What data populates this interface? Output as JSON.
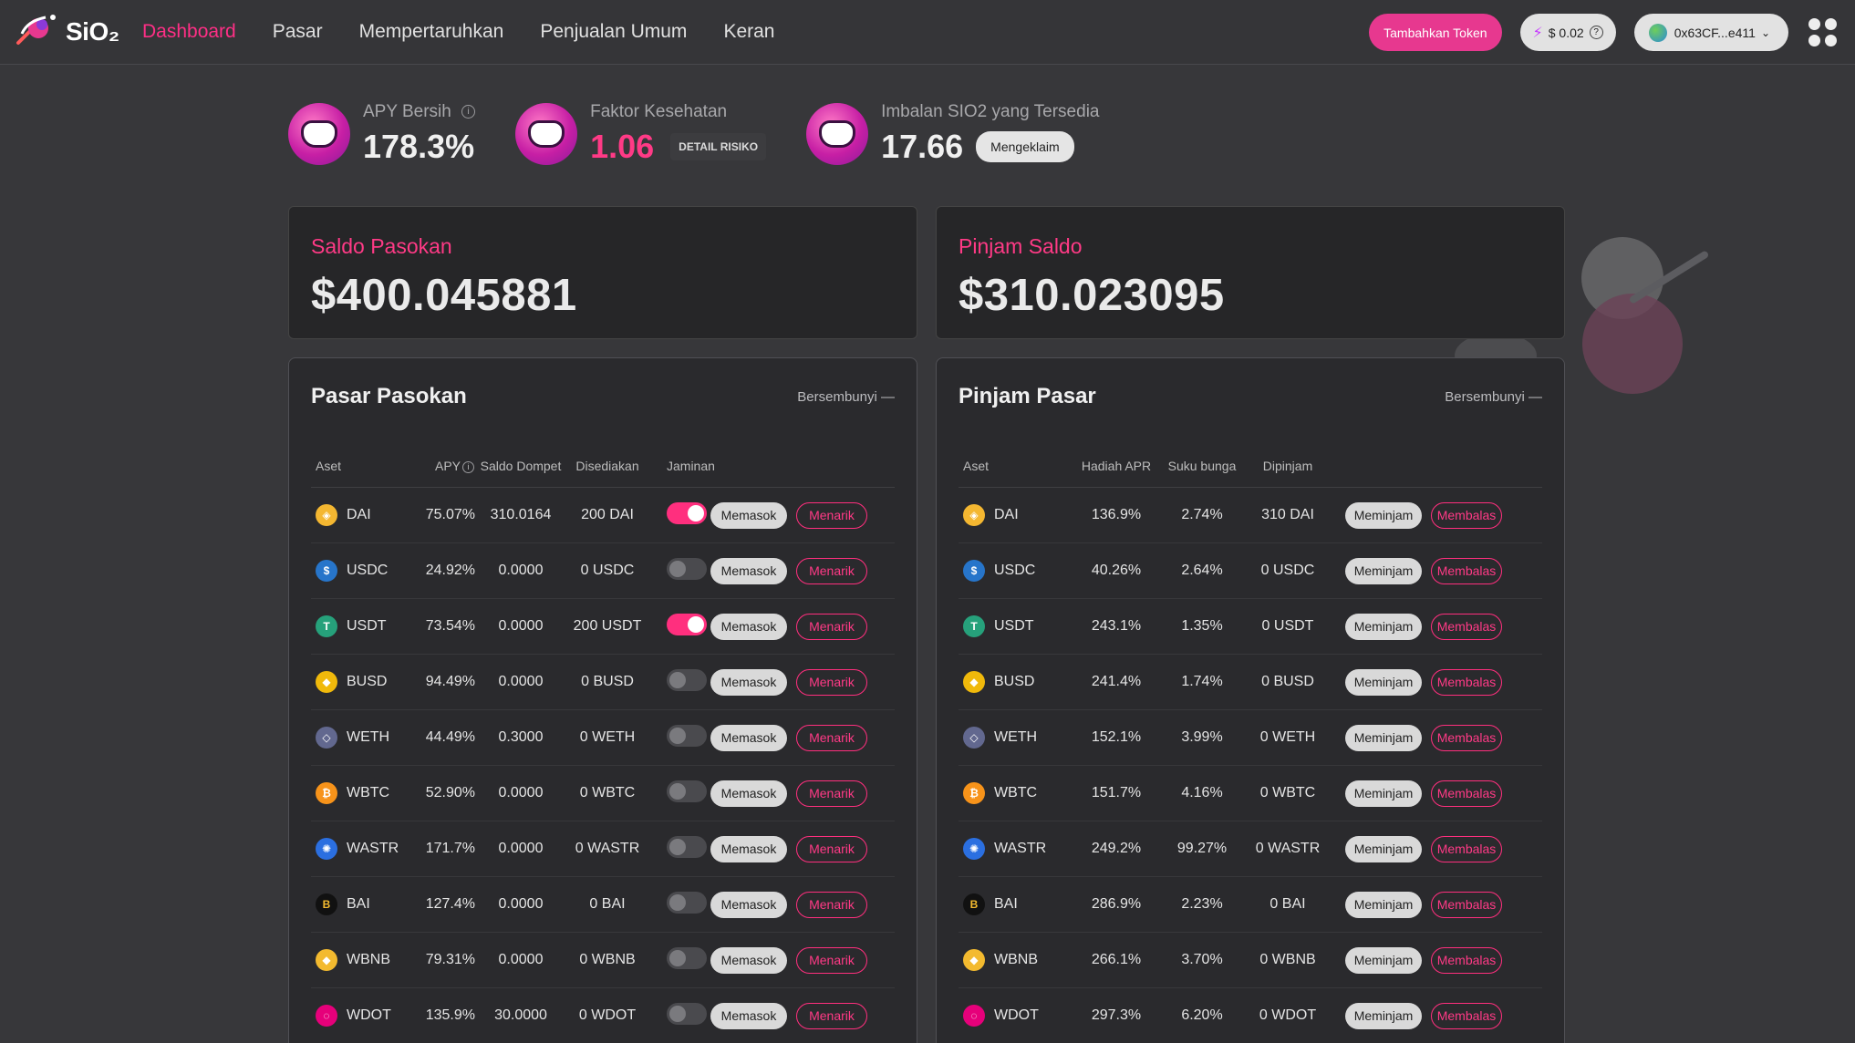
{
  "nav": {
    "logo_text": "SiO₂",
    "links": [
      "Dashboard",
      "Pasar",
      "Mempertaruhkan",
      "Penjualan Umum",
      "Keran"
    ],
    "add_token": "Tambahkan Token",
    "price": "$ 0.02",
    "wallet": "0x63CF...e411"
  },
  "stats": {
    "apy_label": "APY Bersih",
    "apy_value": "178.3%",
    "health_label": "Faktor Kesehatan",
    "health_value": "1.06",
    "risk_detail": "DETAIL RISIKO",
    "reward_label": "Imbalan SIO2 yang Tersedia",
    "reward_value": "17.66",
    "claim": "Mengeklaim"
  },
  "supply_balance": {
    "title": "Saldo Pasokan",
    "value": "$400.045881"
  },
  "borrow_balance": {
    "title": "Pinjam Saldo",
    "value": "$310.023095"
  },
  "supply_market": {
    "title": "Pasar Pasokan",
    "hide": "Bersembunyi —",
    "headers": [
      "Aset",
      "APY",
      "Saldo Dompet",
      "Disediakan",
      "Jaminan"
    ],
    "supply_btn": "Memasok",
    "withdraw_btn": "Menarik",
    "rows": [
      {
        "asset": "DAI",
        "apy": "75.07%",
        "wallet": "310.0164",
        "supplied": "200 DAI",
        "collateral": true
      },
      {
        "asset": "USDC",
        "apy": "24.92%",
        "wallet": "0.0000",
        "supplied": "0 USDC",
        "collateral": false
      },
      {
        "asset": "USDT",
        "apy": "73.54%",
        "wallet": "0.0000",
        "supplied": "200 USDT",
        "collateral": true
      },
      {
        "asset": "BUSD",
        "apy": "94.49%",
        "wallet": "0.0000",
        "supplied": "0 BUSD",
        "collateral": false
      },
      {
        "asset": "WETH",
        "apy": "44.49%",
        "wallet": "0.3000",
        "supplied": "0 WETH",
        "collateral": false
      },
      {
        "asset": "WBTC",
        "apy": "52.90%",
        "wallet": "0.0000",
        "supplied": "0 WBTC",
        "collateral": false
      },
      {
        "asset": "WASTR",
        "apy": "171.7%",
        "wallet": "0.0000",
        "supplied": "0 WASTR",
        "collateral": false
      },
      {
        "asset": "BAI",
        "apy": "127.4%",
        "wallet": "0.0000",
        "supplied": "0 BAI",
        "collateral": false
      },
      {
        "asset": "WBNB",
        "apy": "79.31%",
        "wallet": "0.0000",
        "supplied": "0 WBNB",
        "collateral": false
      },
      {
        "asset": "WDOT",
        "apy": "135.9%",
        "wallet": "30.0000",
        "supplied": "0 WDOT",
        "collateral": false
      }
    ]
  },
  "borrow_market": {
    "title": "Pinjam Pasar",
    "hide": "Bersembunyi —",
    "headers": [
      "Aset",
      "Hadiah APR",
      "Suku bunga",
      "Dipinjam"
    ],
    "borrow_btn": "Meminjam",
    "repay_btn": "Membalas",
    "rows": [
      {
        "asset": "DAI",
        "reward": "136.9%",
        "rate": "2.74%",
        "borrowed": "310 DAI"
      },
      {
        "asset": "USDC",
        "reward": "40.26%",
        "rate": "2.64%",
        "borrowed": "0 USDC"
      },
      {
        "asset": "USDT",
        "reward": "243.1%",
        "rate": "1.35%",
        "borrowed": "0 USDT"
      },
      {
        "asset": "BUSD",
        "reward": "241.4%",
        "rate": "1.74%",
        "borrowed": "0 BUSD"
      },
      {
        "asset": "WETH",
        "reward": "152.1%",
        "rate": "3.99%",
        "borrowed": "0 WETH"
      },
      {
        "asset": "WBTC",
        "reward": "151.7%",
        "rate": "4.16%",
        "borrowed": "0 WBTC"
      },
      {
        "asset": "WASTR",
        "reward": "249.2%",
        "rate": "99.27%",
        "borrowed": "0 WASTR"
      },
      {
        "asset": "BAI",
        "reward": "286.9%",
        "rate": "2.23%",
        "borrowed": "0 BAI"
      },
      {
        "asset": "WBNB",
        "reward": "266.1%",
        "rate": "3.70%",
        "borrowed": "0 WBNB"
      },
      {
        "asset": "WDOT",
        "reward": "297.3%",
        "rate": "6.20%",
        "borrowed": "0 WDOT"
      }
    ]
  },
  "coin_colors": {
    "DAI": "#f4b731",
    "USDC": "#2775ca",
    "USDT": "#26a17b",
    "BUSD": "#f0b90b",
    "WETH": "#62688f",
    "WBTC": "#f7931a",
    "WASTR": "#2b6fe0",
    "BAI": "#111111",
    "WBNB": "#f3ba2f",
    "WDOT": "#e6007a"
  },
  "coin_icons": {
    "DAI": "dai-icon",
    "USDC": "usdc-icon",
    "USDT": "usdt-icon",
    "BUSD": "busd-icon",
    "WETH": "weth-icon",
    "WBTC": "wbtc-icon",
    "WASTR": "wastr-icon",
    "BAI": "bai-icon",
    "WBNB": "wbnb-icon",
    "WDOT": "wdot-icon"
  },
  "coin_glyphs": {
    "DAI": "◈",
    "USDC": "$",
    "USDT": "T",
    "BUSD": "◆",
    "WETH": "◇",
    "WBTC": "₿",
    "WASTR": "✺",
    "BAI": "B",
    "WBNB": "◆",
    "WDOT": "◌"
  }
}
